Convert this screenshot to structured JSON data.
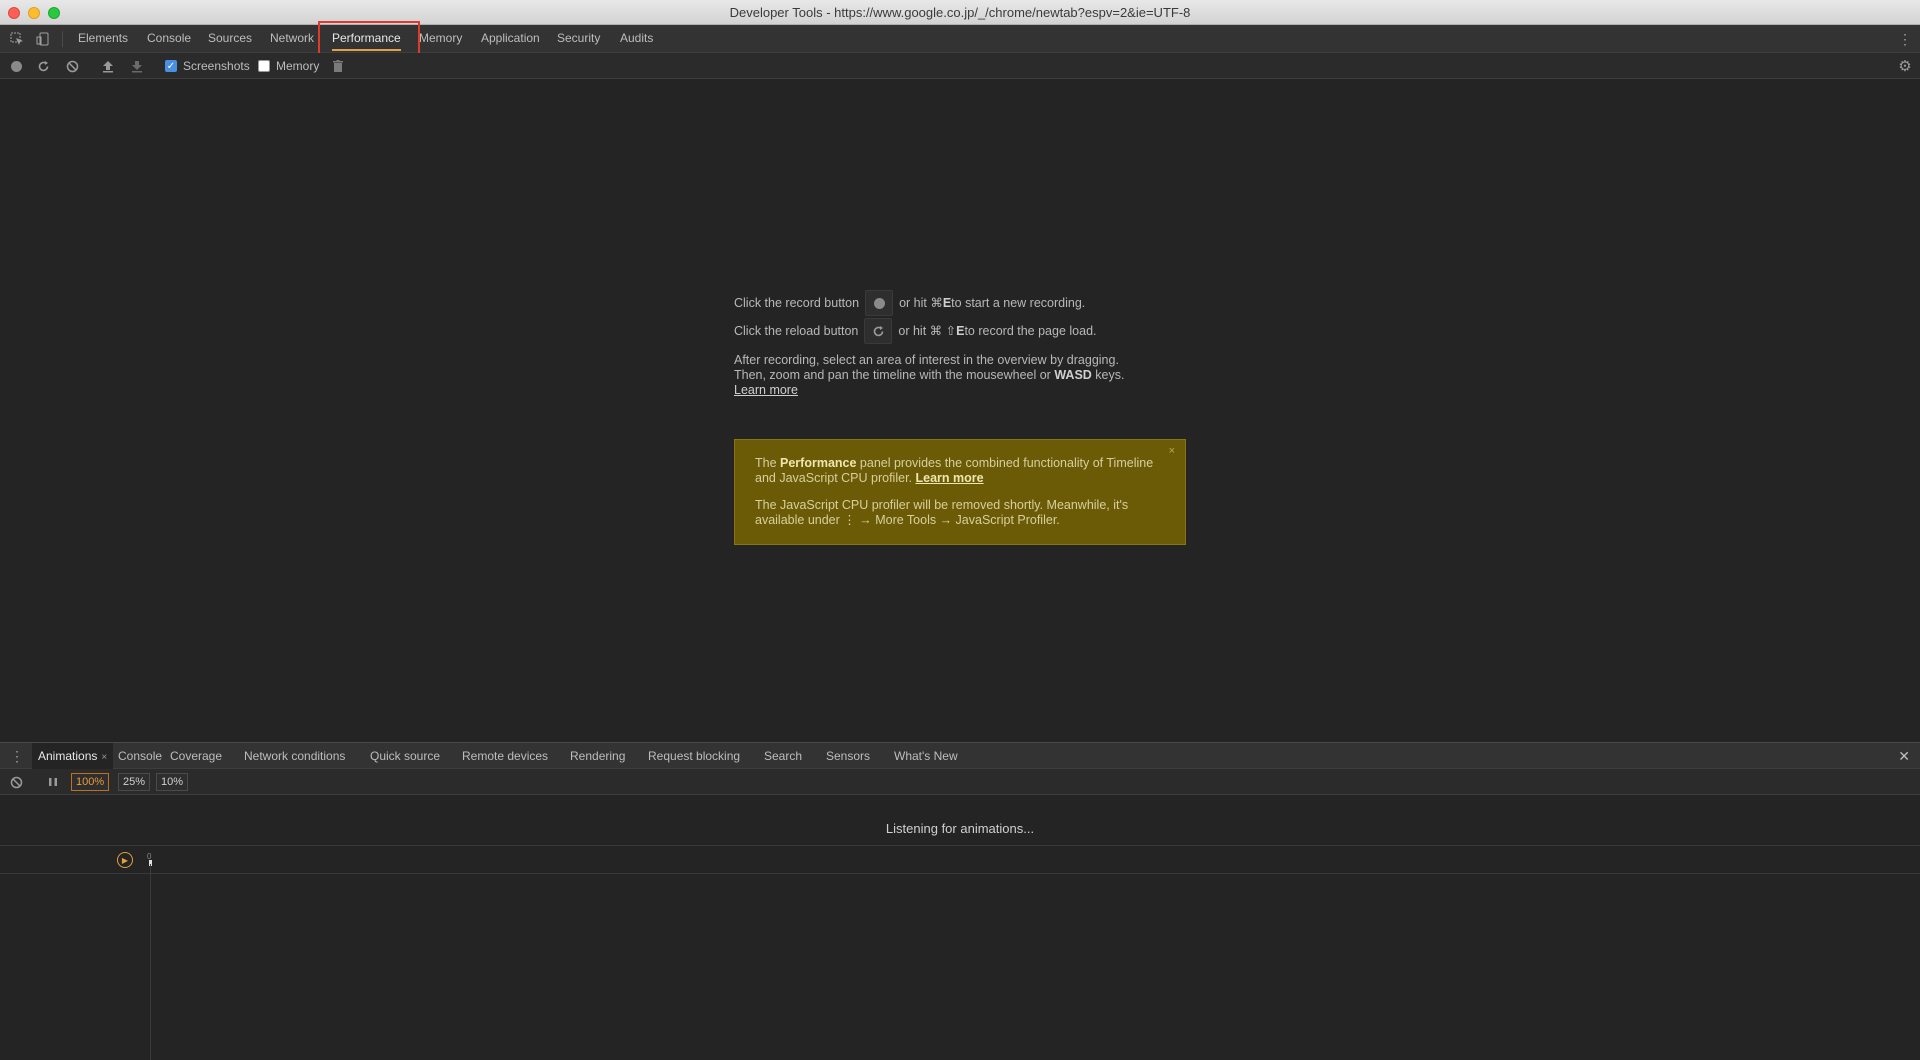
{
  "window": {
    "title": "Developer Tools - https://www.google.co.jp/_/chrome/newtab?espv=2&ie=UTF-8"
  },
  "tabs": [
    "Elements",
    "Console",
    "Sources",
    "Network",
    "Performance",
    "Memory",
    "Application",
    "Security",
    "Audits"
  ],
  "active_tab": "Performance",
  "toolbar": {
    "screenshots_label": "Screenshots",
    "screenshots_checked": true,
    "memory_label": "Memory",
    "memory_checked": false
  },
  "instructions": {
    "record_prefix": "Click the record button",
    "record_suffix_pre": "or hit ⌘ ",
    "record_key": "E",
    "record_suffix_post": " to start a new recording.",
    "reload_prefix": "Click the reload button",
    "reload_suffix_pre": "or hit ⌘ ⇧ ",
    "reload_key": "E",
    "reload_suffix_post": " to record the page load.",
    "after_line1": "After recording, select an area of interest in the overview by dragging.",
    "after_line2_pre": "Then, zoom and pan the timeline with the mousewheel or ",
    "after_line2_keys": "WASD",
    "after_line2_post": " keys.",
    "learn_more": "Learn more"
  },
  "notice": {
    "p1_pre": "The ",
    "p1_bold": "Performance",
    "p1_mid": " panel provides the combined functionality of Timeline and JavaScript CPU profiler. ",
    "p1_link": "Learn more",
    "p2_line1": "The JavaScript CPU profiler will be removed shortly. Meanwhile, it's",
    "p2_line2": "available under ⋮ → More Tools → JavaScript Profiler.",
    "close": "×"
  },
  "drawer": {
    "tabs": [
      "Animations",
      "Console",
      "Coverage",
      "Network conditions",
      "Quick source",
      "Remote devices",
      "Rendering",
      "Request blocking",
      "Search",
      "Sensors",
      "What's New"
    ],
    "active_tab": "Animations",
    "close": "✕"
  },
  "animations": {
    "speeds": [
      "100%",
      "25%",
      "10%"
    ],
    "selected_speed": "100%",
    "listening_text": "Listening for animations...",
    "ruler_zero": "0"
  },
  "colors": {
    "accent": "#e0a050",
    "highlight_box": "#e03a2e",
    "notice_bg": "#6b5b06",
    "checkbox_on": "#4a90e2"
  }
}
